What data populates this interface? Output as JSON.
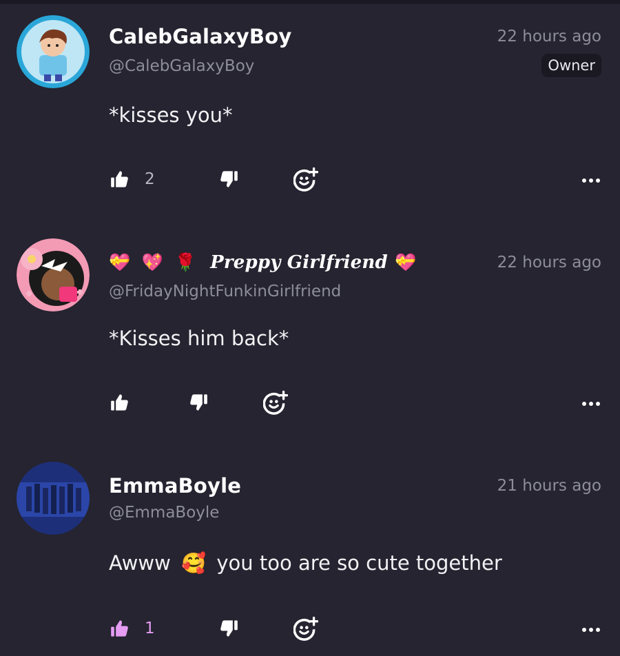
{
  "comments": [
    {
      "display_name": "CalebGalaxyBoy",
      "handle": "@CalebGalaxyBoy",
      "time": "22 hours ago",
      "badge": "Owner",
      "text": "*kisses you*",
      "likes": "2",
      "liked": false,
      "name_emojis_before": "",
      "name_emojis_after": ""
    },
    {
      "display_name": "Preppy Girlfriend",
      "handle": "@FridayNightFunkinGirlfriend",
      "time": "22 hours ago",
      "badge": "",
      "text": "*Kisses him back*",
      "likes": "",
      "liked": false,
      "name_emojis_before": "💝 💖 🌹",
      "name_emojis_after": "💝"
    },
    {
      "display_name": "EmmaBoyle",
      "handle": "@EmmaBoyle",
      "time": "21 hours ago",
      "badge": "",
      "text_before": "Awww",
      "text_emoji": "🥰",
      "text_after": "you too are so cute together",
      "likes": "1",
      "liked": true,
      "name_emojis_before": "",
      "name_emojis_after": ""
    }
  ],
  "colors": {
    "background": "#252430",
    "muted_text": "#8e8d9a",
    "liked_accent": "#e59cf2",
    "badge_bg": "#1a1922"
  },
  "icons": {
    "like": "thumbs-up-icon",
    "dislike": "thumbs-down-icon",
    "react": "add-reaction-icon",
    "more": "more-options-icon"
  }
}
